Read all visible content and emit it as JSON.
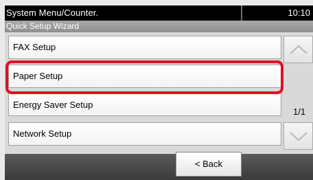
{
  "header": {
    "title": "System Menu/Counter.",
    "time": "10:10"
  },
  "subheader": {
    "title": "Quick Setup Wizard"
  },
  "menu": {
    "items": [
      {
        "label": "FAX Setup"
      },
      {
        "label": "Paper Setup",
        "selected": true
      },
      {
        "label": "Energy Saver Setup"
      },
      {
        "label": "Network Setup"
      }
    ],
    "page_indicator": "1/1"
  },
  "footer": {
    "back_label": "< Back"
  },
  "colors": {
    "highlight": "#e0101e",
    "titlebar": "#000000"
  }
}
